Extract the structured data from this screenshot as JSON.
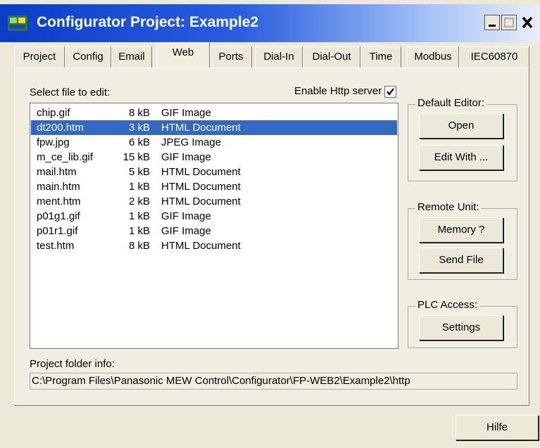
{
  "window": {
    "title": "Configurator Project: Example2"
  },
  "tabs": [
    {
      "label": "Project"
    },
    {
      "label": "Config"
    },
    {
      "label": "Email"
    },
    {
      "label": "Web"
    },
    {
      "label": "Ports"
    },
    {
      "label": "Dial-In"
    },
    {
      "label": "Dial-Out"
    },
    {
      "label": "Time"
    },
    {
      "label": "Modbus"
    },
    {
      "label": "IEC60870"
    }
  ],
  "active_tab": "Web",
  "web": {
    "select_file_label": "Select file to edit:",
    "enable_http_label": "Enable Http server",
    "enable_http_checked": true,
    "files": [
      {
        "name": "chip.gif",
        "size": "8 kB",
        "type": "GIF Image"
      },
      {
        "name": "dt200.htm",
        "size": "3 kB",
        "type": "HTML Document"
      },
      {
        "name": "fpw.jpg",
        "size": "6 kB",
        "type": "JPEG Image"
      },
      {
        "name": "m_ce_lib.gif",
        "size": "15 kB",
        "type": "GIF Image"
      },
      {
        "name": "mail.htm",
        "size": "5 kB",
        "type": "HTML Document"
      },
      {
        "name": "main.htm",
        "size": "1 kB",
        "type": "HTML Document"
      },
      {
        "name": "ment.htm",
        "size": "2 kB",
        "type": "HTML Document"
      },
      {
        "name": "p01g1.gif",
        "size": "1 kB",
        "type": "GIF Image"
      },
      {
        "name": "p01r1.gif",
        "size": "1 kB",
        "type": "GIF Image"
      },
      {
        "name": "test.htm",
        "size": "8 kB",
        "type": "HTML Document"
      }
    ],
    "selected_file": "dt200.htm",
    "default_editor": {
      "title": "Default Editor:",
      "open": "Open",
      "edit_with": "Edit With ..."
    },
    "remote_unit": {
      "title": "Remote Unit:",
      "memory": "Memory ?",
      "send_file": "Send File"
    },
    "plc_access": {
      "title": "PLC Access:",
      "settings": "Settings"
    },
    "project_folder_label": "Project folder info:",
    "project_folder_path": "C:\\Program Files\\Panasonic MEW Control\\Configurator\\FP-WEB2\\Example2\\http"
  },
  "footer": {
    "help": "Hilfe"
  },
  "colors": {
    "title_gradient_start": "#0a3dc8",
    "selection": "#316ac5",
    "face": "#ece9d8"
  }
}
